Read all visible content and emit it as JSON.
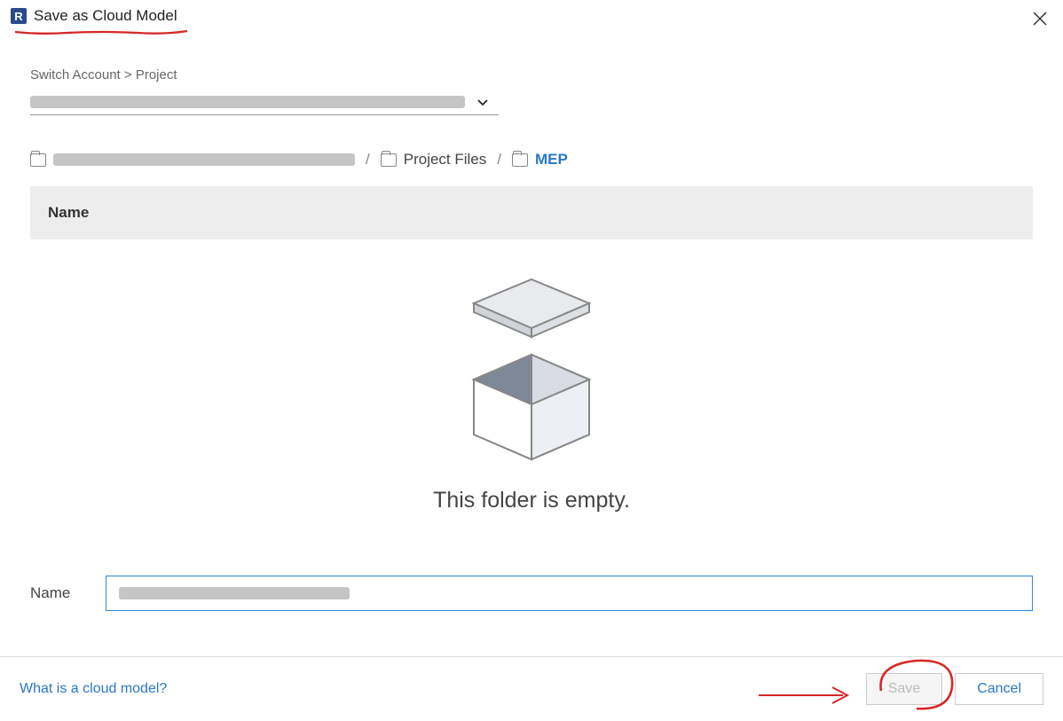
{
  "title": "Save as Cloud Model",
  "breadcrumb_label": "Switch Account > Project",
  "path": {
    "segment_2": "Project Files",
    "current": "MEP"
  },
  "table": {
    "column_name": "Name"
  },
  "empty_message": "This folder is empty.",
  "name_field": {
    "label": "Name"
  },
  "footer": {
    "help_text": "What is a cloud model?",
    "save_label": "Save",
    "cancel_label": "Cancel"
  }
}
